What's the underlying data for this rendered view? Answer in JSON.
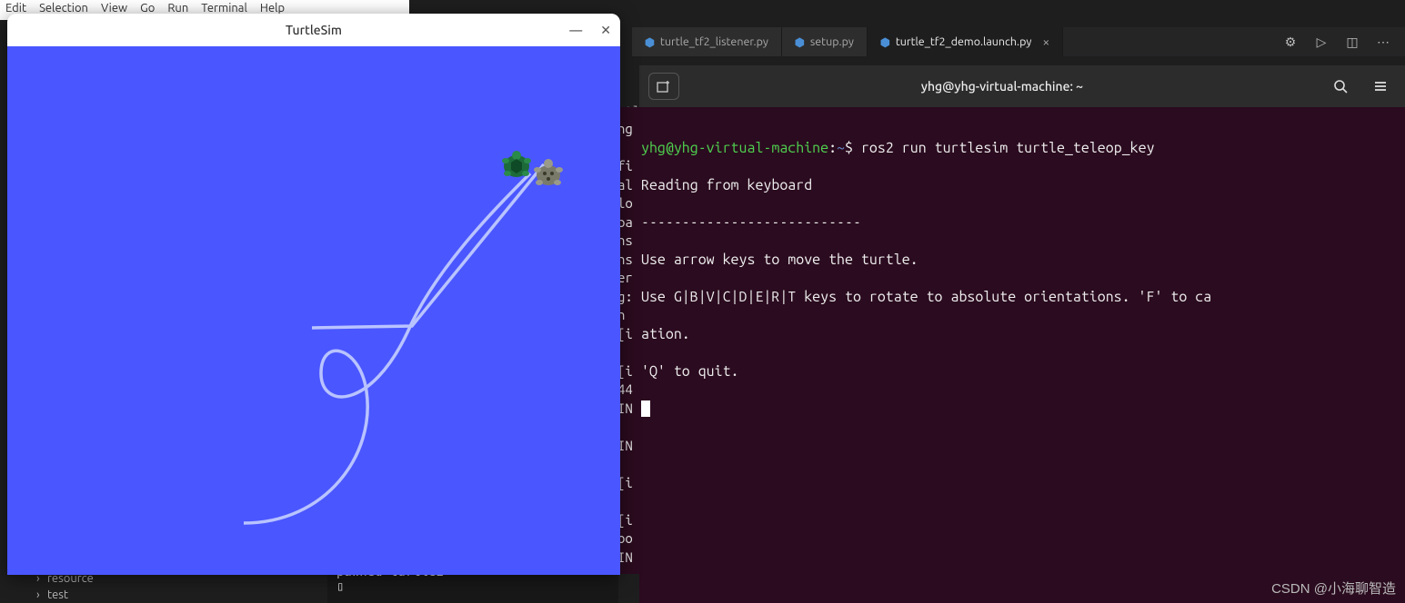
{
  "menubar": [
    "Edit",
    "Selection",
    "View",
    "Go",
    "Run",
    "Terminal",
    "Help"
  ],
  "vscode_tabs": {
    "items": [
      {
        "label": "turtle_tf2_listener.py",
        "active": false
      },
      {
        "label": "setup.py",
        "active": false
      },
      {
        "label": "turtle_tf2_demo.launch.py",
        "active": true
      }
    ]
  },
  "sidebar": {
    "items": [
      {
        "label": "resource"
      },
      {
        "label": "test"
      }
    ]
  },
  "turtlesim": {
    "title": "TurtleSim"
  },
  "terminal": {
    "title": "yhg@yhg-virtual-machine: ~",
    "prompt_user": "yhg@yhg-virtual-machine",
    "prompt_colon": ":",
    "prompt_path": "~",
    "prompt_dollar": "$",
    "command": "ros2 run turtlesim turtle_teleop_key",
    "lines": [
      "Reading from keyboard",
      "---------------------------",
      "Use arrow keys to move the turtle.",
      "Use G|B|V|C|D|E|R|T keys to rotate to absolute orientations. 'F' to ca",
      "ation.",
      "'Q' to quit."
    ]
  },
  "partial_col": {
    "top": "rtl",
    "lines": [
      "hg",
      "",
      "fi",
      "al",
      "lo",
      "pa",
      "ns",
      "ns",
      "er",
      "g:",
      "n ",
      "[i",
      "",
      "[i",
      "44",
      "IN",
      "",
      "IN",
      "",
      "[i",
      "",
      "[i",
      "oo",
      "IN"
    ]
  },
  "bottom_editor": {
    "line1": "pawned  turtle2",
    "cursor": "▯"
  },
  "watermark": "CSDN @小海聊智造"
}
